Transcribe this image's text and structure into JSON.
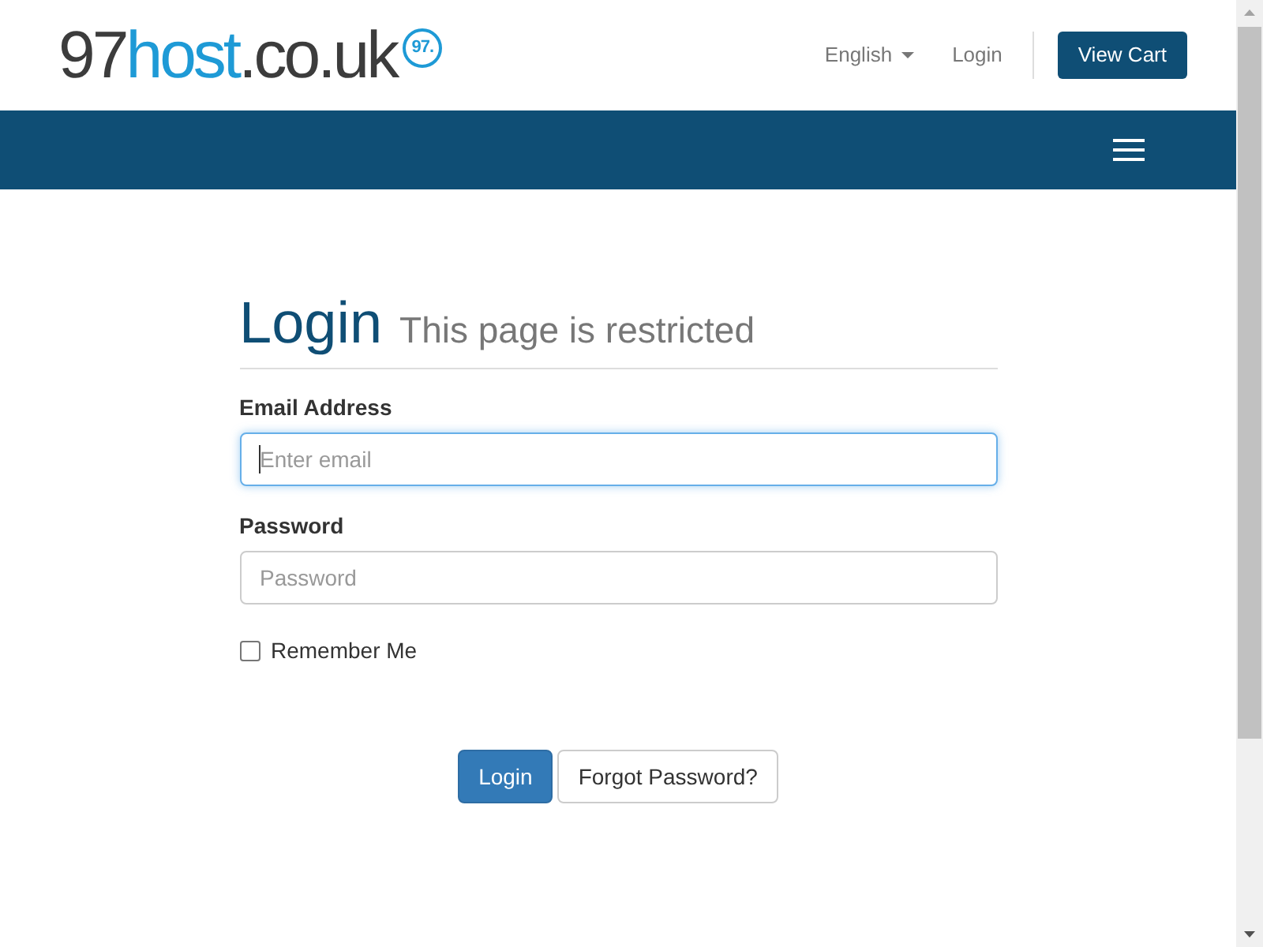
{
  "header": {
    "logo": {
      "prefix": "97",
      "highlight": "host",
      "suffix": ".co.uk",
      "badge": "97."
    },
    "nav": [
      {
        "label": "English",
        "kind": "dropdown"
      },
      {
        "label": "Login",
        "kind": "link"
      }
    ],
    "cart_button": "View Cart"
  },
  "login": {
    "title": "Login",
    "subtitle": "This page is restricted",
    "fields": [
      {
        "label": "Email Address",
        "placeholder": "Enter email",
        "focused": true
      },
      {
        "label": "Password",
        "placeholder": "Password",
        "focused": false
      }
    ],
    "remember": {
      "label": "Remember Me",
      "checked": false
    },
    "buttons": [
      {
        "label": "Login",
        "kind": "primary"
      },
      {
        "label": "Forgot Password?",
        "kind": "default"
      }
    ]
  }
}
